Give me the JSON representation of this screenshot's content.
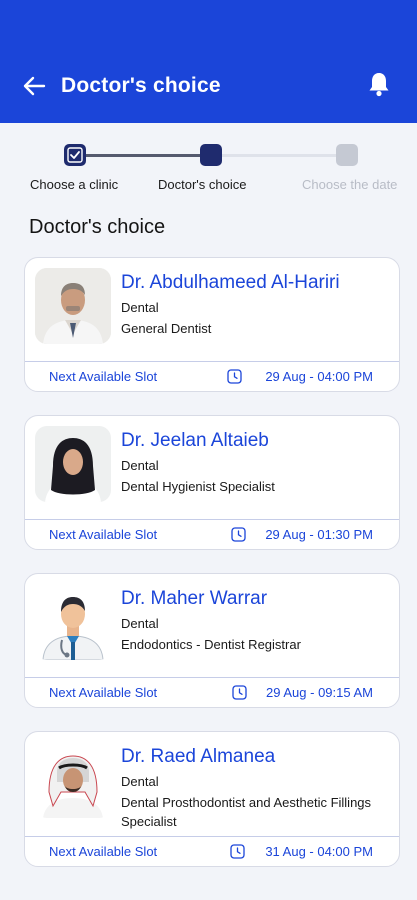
{
  "header": {
    "title": "Doctor's choice",
    "background": "#1b45d9"
  },
  "stepper": {
    "steps": [
      {
        "label": "Choose a clinic",
        "state": "completed"
      },
      {
        "label": "Doctor's choice",
        "state": "current"
      },
      {
        "label": "Choose the date",
        "state": "upcoming"
      }
    ]
  },
  "section": {
    "title": "Doctor's choice"
  },
  "doctors": [
    {
      "name": "Dr. Abdulhameed Al-Hariri",
      "department": "Dental",
      "specialty": "General Dentist",
      "slot_label": "Next Available Slot",
      "slot_time": "29 Aug - 04:00 PM",
      "photo": "doctor-photo-man"
    },
    {
      "name": "Dr. Jeelan Altaieb",
      "department": "Dental",
      "specialty": "Dental Hygienist Specialist",
      "slot_label": "Next Available Slot",
      "slot_time": "29 Aug - 01:30 PM",
      "photo": "doctor-photo-woman-hijab"
    },
    {
      "name": "Dr. Maher Warrar",
      "department": "Dental",
      "specialty": "Endodontics - Dentist Registrar",
      "slot_label": "Next Available Slot",
      "slot_time": "29 Aug - 09:15 AM",
      "photo": "doctor-avatar-placeholder"
    },
    {
      "name": "Dr. Raed Almanea",
      "department": "Dental",
      "specialty": "Dental Prosthodontist and Aesthetic Fillings Specialist",
      "slot_label": "Next Available Slot",
      "slot_time": "31 Aug - 04:00 PM",
      "photo": "doctor-photo-man-shemagh"
    }
  ],
  "colors": {
    "accent": "#1b45d9",
    "step_active": "#1f2b6e",
    "step_inactive": "#c5c9d3"
  }
}
